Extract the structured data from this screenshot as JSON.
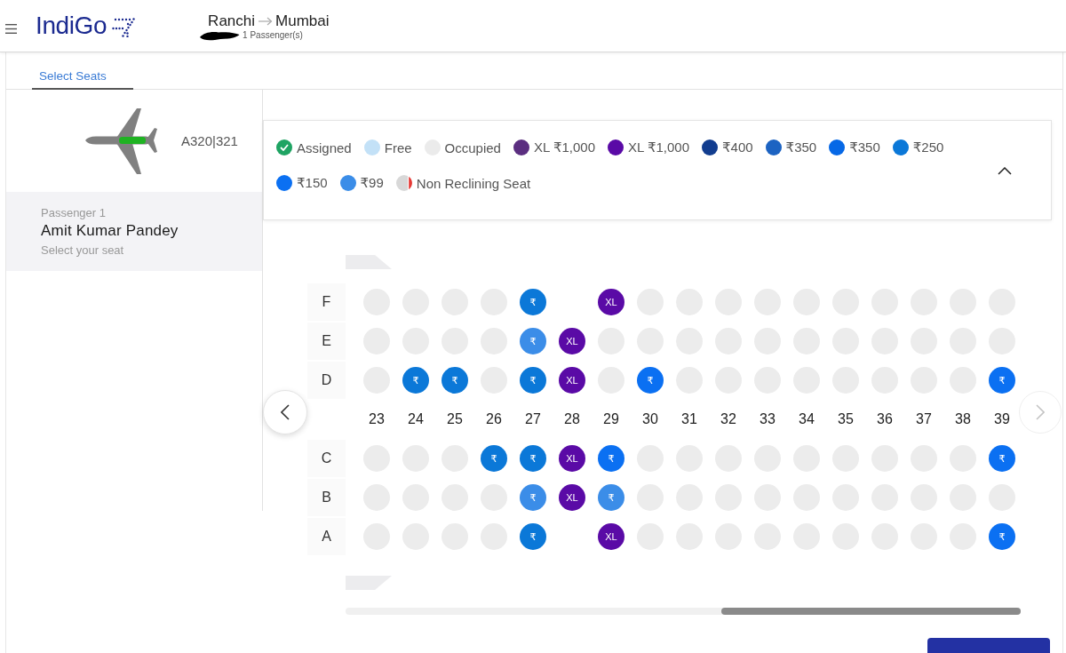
{
  "header": {
    "brand": "IndiGo",
    "origin": "Ranchi",
    "destination": "Mumbai",
    "passengers": "1 Passenger(s)"
  },
  "tabs": [
    {
      "label": "Select Seats",
      "selected": true
    }
  ],
  "aircraft": {
    "model": "A320|321"
  },
  "passenger": {
    "title": "Passenger 1",
    "name": "Amit Kumar Pandey",
    "hint": "Select your seat"
  },
  "legend": {
    "expanded": true,
    "items": [
      {
        "kind": "assigned",
        "label": "Assigned"
      },
      {
        "kind": "dot",
        "label": "Free",
        "color": "#c3e1f7"
      },
      {
        "kind": "dot",
        "label": "Occupied",
        "color": "#ebebeb"
      },
      {
        "kind": "dot",
        "label": "XL ₹1,000",
        "color": "#5b2e80"
      },
      {
        "kind": "dot",
        "label": "XL ₹1,000",
        "color": "#5a0aa6"
      },
      {
        "kind": "dot",
        "label": "₹400",
        "color": "#123d8f"
      },
      {
        "kind": "dot",
        "label": "₹350",
        "color": "#1c63c2"
      },
      {
        "kind": "dot",
        "label": "₹350",
        "color": "#0668e6"
      },
      {
        "kind": "dot",
        "label": "₹250",
        "color": "#0b78d8"
      },
      {
        "kind": "dot",
        "label": "₹150",
        "color": "#0b70f2"
      },
      {
        "kind": "dot",
        "label": "₹99",
        "color": "#3b8de8"
      },
      {
        "kind": "non_reclining",
        "label": "Non Reclining Seat"
      }
    ]
  },
  "seat_map": {
    "previous": {
      "disabled": false
    },
    "next": {
      "disabled": true
    },
    "rows": [
      {
        "kind": "seats",
        "letter": "F",
        "seats": [
          {
            "kind": "occupied"
          },
          {
            "kind": "occupied"
          },
          {
            "kind": "occupied"
          },
          {
            "kind": "occupied"
          },
          {
            "kind": "available",
            "label": "₹",
            "color": "#0b78d8"
          },
          {
            "kind": "gap"
          },
          {
            "kind": "available",
            "label": "XL",
            "color": "#5a0aa6"
          },
          {
            "kind": "occupied"
          },
          {
            "kind": "occupied"
          },
          {
            "kind": "occupied"
          },
          {
            "kind": "occupied"
          },
          {
            "kind": "occupied"
          },
          {
            "kind": "occupied"
          },
          {
            "kind": "occupied"
          },
          {
            "kind": "occupied"
          },
          {
            "kind": "occupied"
          },
          {
            "kind": "occupied"
          }
        ]
      },
      {
        "kind": "seats",
        "letter": "E",
        "seats": [
          {
            "kind": "occupied"
          },
          {
            "kind": "occupied"
          },
          {
            "kind": "occupied"
          },
          {
            "kind": "occupied"
          },
          {
            "kind": "available",
            "label": "₹",
            "color": "#3b8de8"
          },
          {
            "kind": "available",
            "label": "XL",
            "color": "#5a0aa6"
          },
          {
            "kind": "occupied"
          },
          {
            "kind": "occupied"
          },
          {
            "kind": "occupied"
          },
          {
            "kind": "occupied"
          },
          {
            "kind": "occupied"
          },
          {
            "kind": "occupied"
          },
          {
            "kind": "occupied"
          },
          {
            "kind": "occupied"
          },
          {
            "kind": "occupied"
          },
          {
            "kind": "occupied"
          },
          {
            "kind": "occupied"
          }
        ]
      },
      {
        "kind": "seats",
        "letter": "D",
        "seats": [
          {
            "kind": "occupied"
          },
          {
            "kind": "available",
            "label": "₹",
            "color": "#0b78d8"
          },
          {
            "kind": "available",
            "label": "₹",
            "color": "#0b78d8"
          },
          {
            "kind": "occupied"
          },
          {
            "kind": "available",
            "label": "₹",
            "color": "#0b78d8"
          },
          {
            "kind": "available",
            "label": "XL",
            "color": "#5a0aa6"
          },
          {
            "kind": "occupied"
          },
          {
            "kind": "available",
            "label": "₹",
            "color": "#0b70f2"
          },
          {
            "kind": "occupied"
          },
          {
            "kind": "occupied"
          },
          {
            "kind": "occupied"
          },
          {
            "kind": "occupied"
          },
          {
            "kind": "occupied"
          },
          {
            "kind": "occupied"
          },
          {
            "kind": "occupied"
          },
          {
            "kind": "occupied"
          },
          {
            "kind": "available",
            "label": "₹",
            "color": "#0b70f2"
          }
        ]
      },
      {
        "kind": "aisle",
        "numbers": [
          "23",
          "24",
          "25",
          "26",
          "27",
          "28",
          "29",
          "30",
          "31",
          "32",
          "33",
          "34",
          "35",
          "36",
          "37",
          "38",
          "39"
        ]
      },
      {
        "kind": "seats",
        "letter": "C",
        "seats": [
          {
            "kind": "occupied"
          },
          {
            "kind": "occupied"
          },
          {
            "kind": "occupied"
          },
          {
            "kind": "available",
            "label": "₹",
            "color": "#0b78d8"
          },
          {
            "kind": "available",
            "label": "₹",
            "color": "#0b78d8"
          },
          {
            "kind": "available",
            "label": "XL",
            "color": "#5a0aa6"
          },
          {
            "kind": "available",
            "label": "₹",
            "color": "#0b70f2"
          },
          {
            "kind": "occupied"
          },
          {
            "kind": "occupied"
          },
          {
            "kind": "occupied"
          },
          {
            "kind": "occupied"
          },
          {
            "kind": "occupied"
          },
          {
            "kind": "occupied"
          },
          {
            "kind": "occupied"
          },
          {
            "kind": "occupied"
          },
          {
            "kind": "occupied"
          },
          {
            "kind": "available",
            "label": "₹",
            "color": "#0b70f2"
          }
        ]
      },
      {
        "kind": "seats",
        "letter": "B",
        "seats": [
          {
            "kind": "occupied"
          },
          {
            "kind": "occupied"
          },
          {
            "kind": "occupied"
          },
          {
            "kind": "occupied"
          },
          {
            "kind": "available",
            "label": "₹",
            "color": "#3b8de8"
          },
          {
            "kind": "available",
            "label": "XL",
            "color": "#5a0aa6"
          },
          {
            "kind": "available",
            "label": "₹",
            "color": "#3b8de8"
          },
          {
            "kind": "occupied"
          },
          {
            "kind": "occupied"
          },
          {
            "kind": "occupied"
          },
          {
            "kind": "occupied"
          },
          {
            "kind": "occupied"
          },
          {
            "kind": "occupied"
          },
          {
            "kind": "occupied"
          },
          {
            "kind": "occupied"
          },
          {
            "kind": "occupied"
          },
          {
            "kind": "occupied"
          }
        ]
      },
      {
        "kind": "seats",
        "letter": "A",
        "seats": [
          {
            "kind": "occupied"
          },
          {
            "kind": "occupied"
          },
          {
            "kind": "occupied"
          },
          {
            "kind": "occupied"
          },
          {
            "kind": "available",
            "label": "₹",
            "color": "#0b78d8"
          },
          {
            "kind": "gap"
          },
          {
            "kind": "available",
            "label": "XL",
            "color": "#5a0aa6"
          },
          {
            "kind": "occupied"
          },
          {
            "kind": "occupied"
          },
          {
            "kind": "occupied"
          },
          {
            "kind": "occupied"
          },
          {
            "kind": "occupied"
          },
          {
            "kind": "occupied"
          },
          {
            "kind": "occupied"
          },
          {
            "kind": "occupied"
          },
          {
            "kind": "occupied"
          },
          {
            "kind": "available",
            "label": "₹",
            "color": "#0b70f2"
          }
        ]
      }
    ]
  }
}
